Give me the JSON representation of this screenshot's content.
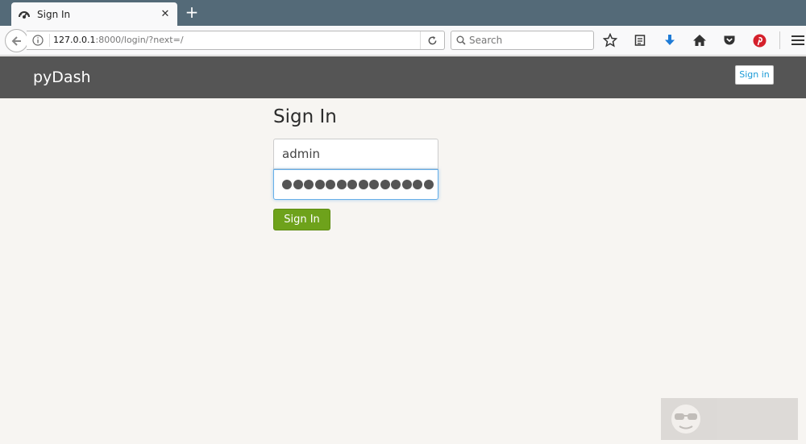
{
  "browser": {
    "tab_title": "Sign In",
    "close_glyph": "✕",
    "new_tab_glyph": "+",
    "url_host": "127.0.0.1",
    "url_rest": ":8000/login/?next=/",
    "search_placeholder": "Search",
    "icons": [
      "bookmark-star-icon",
      "reading-list-icon",
      "download-icon",
      "home-icon",
      "pocket-icon",
      "pinterest-icon",
      "menu-icon"
    ]
  },
  "header": {
    "brand": "pyDash",
    "signin_label": "Sign in"
  },
  "form": {
    "title": "Sign In",
    "username_value": "admin",
    "password_mask_count": 14,
    "submit_label": "Sign In"
  },
  "colors": {
    "header_bg": "#555555",
    "submit_bg": "#6ea21b",
    "link_accent": "#1a9ad6",
    "page_bg": "#f7f5f2"
  }
}
